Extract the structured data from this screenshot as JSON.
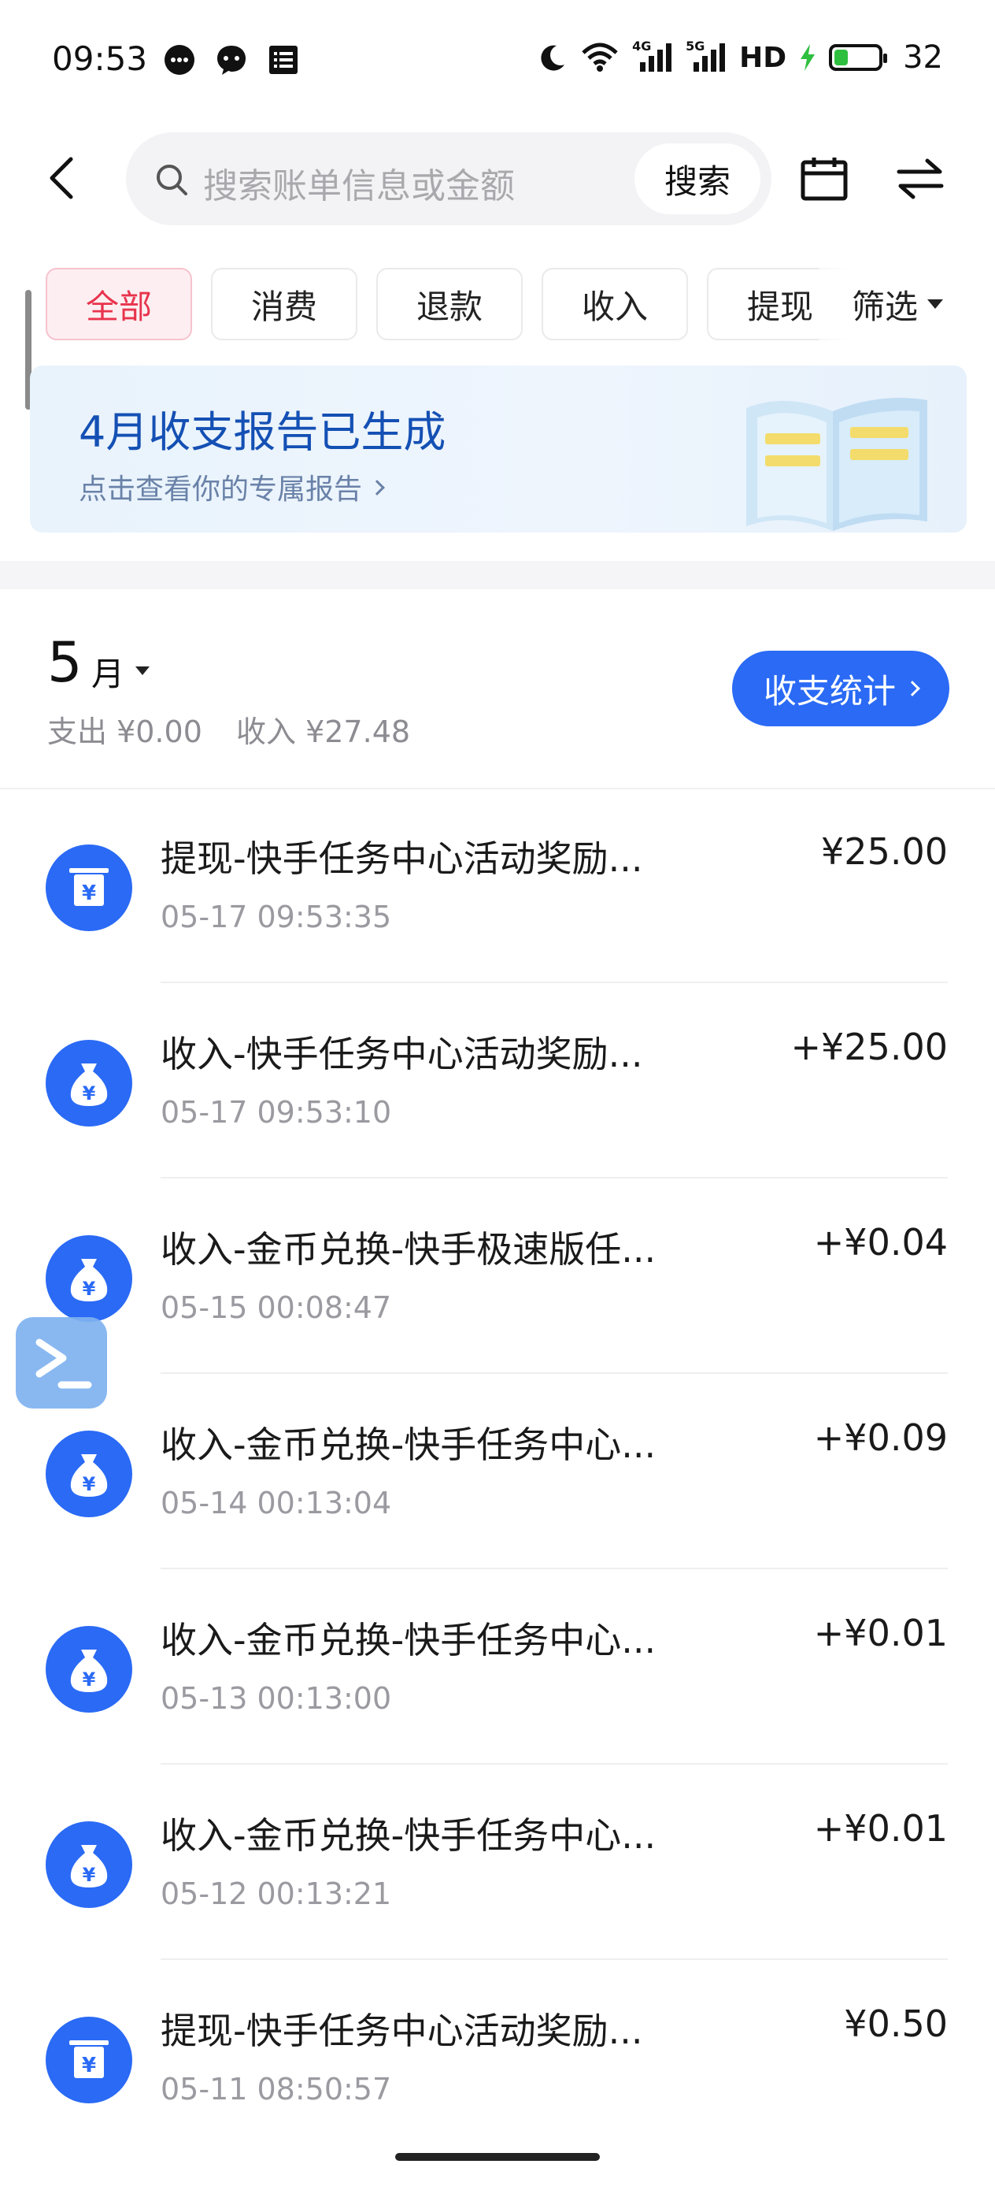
{
  "status_bar": {
    "time": "09:53",
    "network_4g": "4G",
    "network_5g": "5G",
    "hd": "HD",
    "battery": "32",
    "battery_level": 0.32,
    "charging_color": "#2fbf3f"
  },
  "header": {
    "search_placeholder": "搜索账单信息或金额",
    "search_button": "搜索"
  },
  "tabs": [
    {
      "label": "全部",
      "active": true
    },
    {
      "label": "消费",
      "active": false
    },
    {
      "label": "退款",
      "active": false
    },
    {
      "label": "收入",
      "active": false
    },
    {
      "label": "提现",
      "active": false
    }
  ],
  "filter_label": "筛选",
  "banner": {
    "title": "4月收支报告已生成",
    "subtitle": "点击查看你的专属报告"
  },
  "summary": {
    "month": "5",
    "month_unit": "月",
    "expense": "支出 ¥0.00",
    "income": "收入 ¥27.48",
    "stats_button": "收支统计"
  },
  "transactions": [
    {
      "icon": "atm-withdraw-icon",
      "title": "提现-快手任务中心活动奖励...",
      "time": "05-17 09:53:35",
      "amount": "¥25.00"
    },
    {
      "icon": "money-bag-icon",
      "title": "收入-快手任务中心活动奖励...",
      "time": "05-17 09:53:10",
      "amount": "+¥25.00"
    },
    {
      "icon": "money-bag-icon",
      "title": "收入-金币兑换-快手极速版任...",
      "time": "05-15 00:08:47",
      "amount": "+¥0.04"
    },
    {
      "icon": "money-bag-icon",
      "title": "收入-金币兑换-快手任务中心...",
      "time": "05-14 00:13:04",
      "amount": "+¥0.09"
    },
    {
      "icon": "money-bag-icon",
      "title": "收入-金币兑换-快手任务中心...",
      "time": "05-13 00:13:00",
      "amount": "+¥0.01"
    },
    {
      "icon": "money-bag-icon",
      "title": "收入-金币兑换-快手任务中心...",
      "time": "05-12 00:13:21",
      "amount": "+¥0.01"
    },
    {
      "icon": "atm-withdraw-icon",
      "title": "提现-快手任务中心活动奖励...",
      "time": "05-11 08:50:57",
      "amount": "¥0.50"
    }
  ],
  "colors": {
    "accent": "#2a6af5",
    "active_tab_text": "#e8344d",
    "banner_title": "#1450b4"
  }
}
